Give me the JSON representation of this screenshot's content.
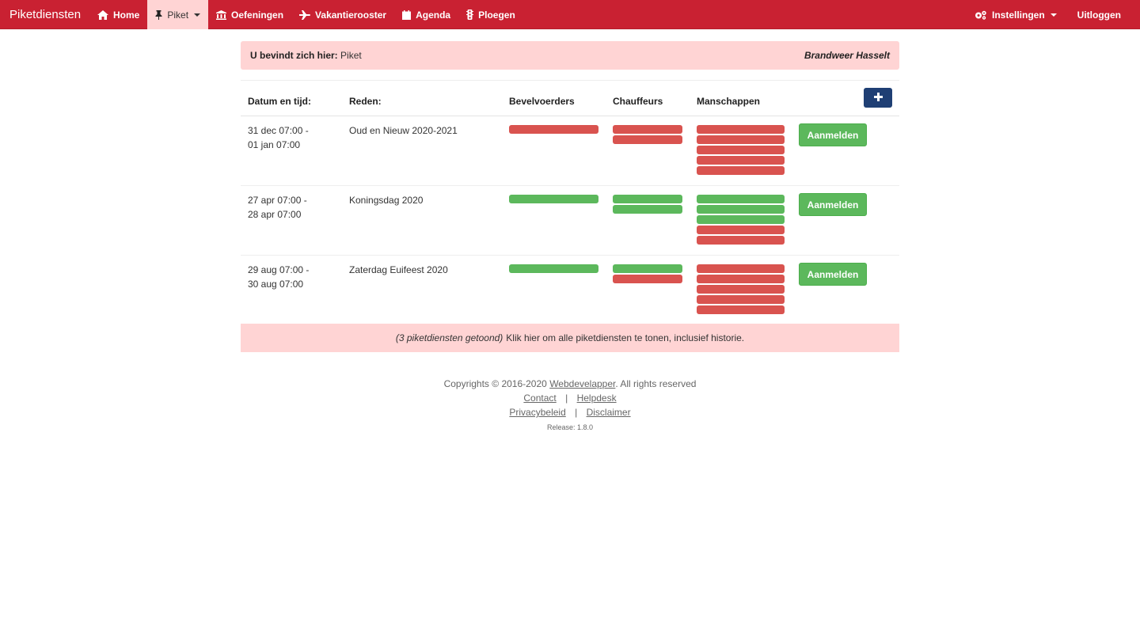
{
  "nav": {
    "brand": "Piketdiensten",
    "items": [
      {
        "label": "Home",
        "icon": "home-icon"
      },
      {
        "label": "Piket",
        "icon": "pin-icon",
        "active": true,
        "dropdown": true
      },
      {
        "label": "Oefeningen",
        "icon": "bank-icon"
      },
      {
        "label": "Vakantierooster",
        "icon": "plane-icon"
      },
      {
        "label": "Agenda",
        "icon": "calendar-icon"
      },
      {
        "label": "Ploegen",
        "icon": "traffic-light-icon"
      }
    ],
    "settings_label": "Instellingen",
    "settings_icon": "gears-icon",
    "logout_label": "Uitloggen"
  },
  "breadcrumb": {
    "prefix": "U bevindt zich hier:",
    "current": "Piket",
    "organization": "Brandweer Hasselt"
  },
  "table": {
    "headers": {
      "datetime": "Datum en tijd:",
      "reason": "Reden:",
      "commanders": "Bevelvoerders",
      "drivers": "Chauffeurs",
      "crew": "Manschappen"
    },
    "add_icon": "plus-icon",
    "action_label": "Aanmelden",
    "rows": [
      {
        "date_line1": "31 dec 07:00 -",
        "date_line2": "01 jan 07:00",
        "reason": "Oud en Nieuw 2020-2021",
        "commanders": [
          "red"
        ],
        "drivers": [
          "red",
          "red"
        ],
        "crew": [
          "red",
          "red",
          "red",
          "red",
          "red"
        ]
      },
      {
        "date_line1": "27 apr 07:00 -",
        "date_line2": "28 apr 07:00",
        "reason": "Koningsdag 2020",
        "commanders": [
          "green"
        ],
        "drivers": [
          "green",
          "green"
        ],
        "crew": [
          "green",
          "green",
          "green",
          "red",
          "red"
        ]
      },
      {
        "date_line1": "29 aug 07:00 -",
        "date_line2": "30 aug 07:00",
        "reason": "Zaterdag Euifeest 2020",
        "commanders": [
          "green"
        ],
        "drivers": [
          "green",
          "red"
        ],
        "crew": [
          "red",
          "red",
          "red",
          "red",
          "red"
        ]
      }
    ]
  },
  "show_all": {
    "count_text": "(3 piketdiensten getoond)",
    "link_text": "Klik hier om alle piketdiensten te tonen, inclusief historie."
  },
  "footer": {
    "copyright_prefix": "Copyrights © 2016-2020",
    "company": "Webdevelapper",
    "copyright_suffix": ". All rights reserved",
    "contact": "Contact",
    "helpdesk": "Helpdesk",
    "privacy": "Privacybeleid",
    "disclaimer": "Disclaimer",
    "separator": "|",
    "release": "Release: 1.8.0"
  },
  "colors": {
    "navbar": "#c92132",
    "highlight": "#ffd4d4",
    "bar_green": "#5cb85c",
    "bar_red": "#d9534f",
    "add_button": "#1f3f74"
  }
}
